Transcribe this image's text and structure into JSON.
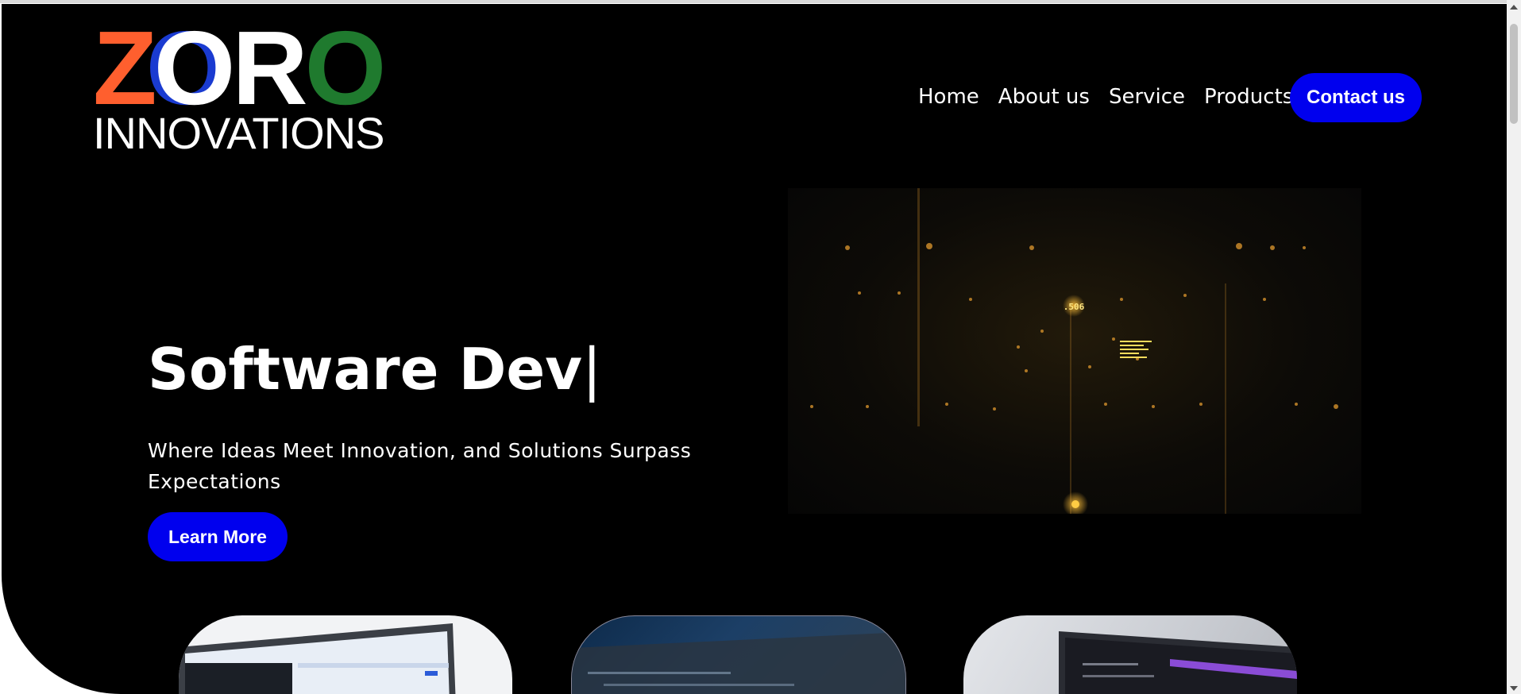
{
  "logo": {
    "letters": [
      "Z",
      "O",
      "R",
      "O"
    ],
    "letter_colors": [
      "#ff5f2e",
      "#ffffff",
      "#ffffff",
      "#1f7a2e"
    ],
    "accent_blue": "#1a3bd1",
    "subtitle": "INNOVATIONS"
  },
  "nav": {
    "links": [
      "Home",
      "About us",
      "Service",
      "Products"
    ],
    "contact_label": "Contact us"
  },
  "hero": {
    "headline": "Software Dev",
    "cursor": "|",
    "tagline": "Where Ideas Meet Innovation, and Solutions Surpass Expectations",
    "cta_label": "Learn More",
    "media_badge": ".506"
  },
  "colors": {
    "background": "#000000",
    "primary_button": "#0000ee",
    "text": "#ffffff"
  }
}
